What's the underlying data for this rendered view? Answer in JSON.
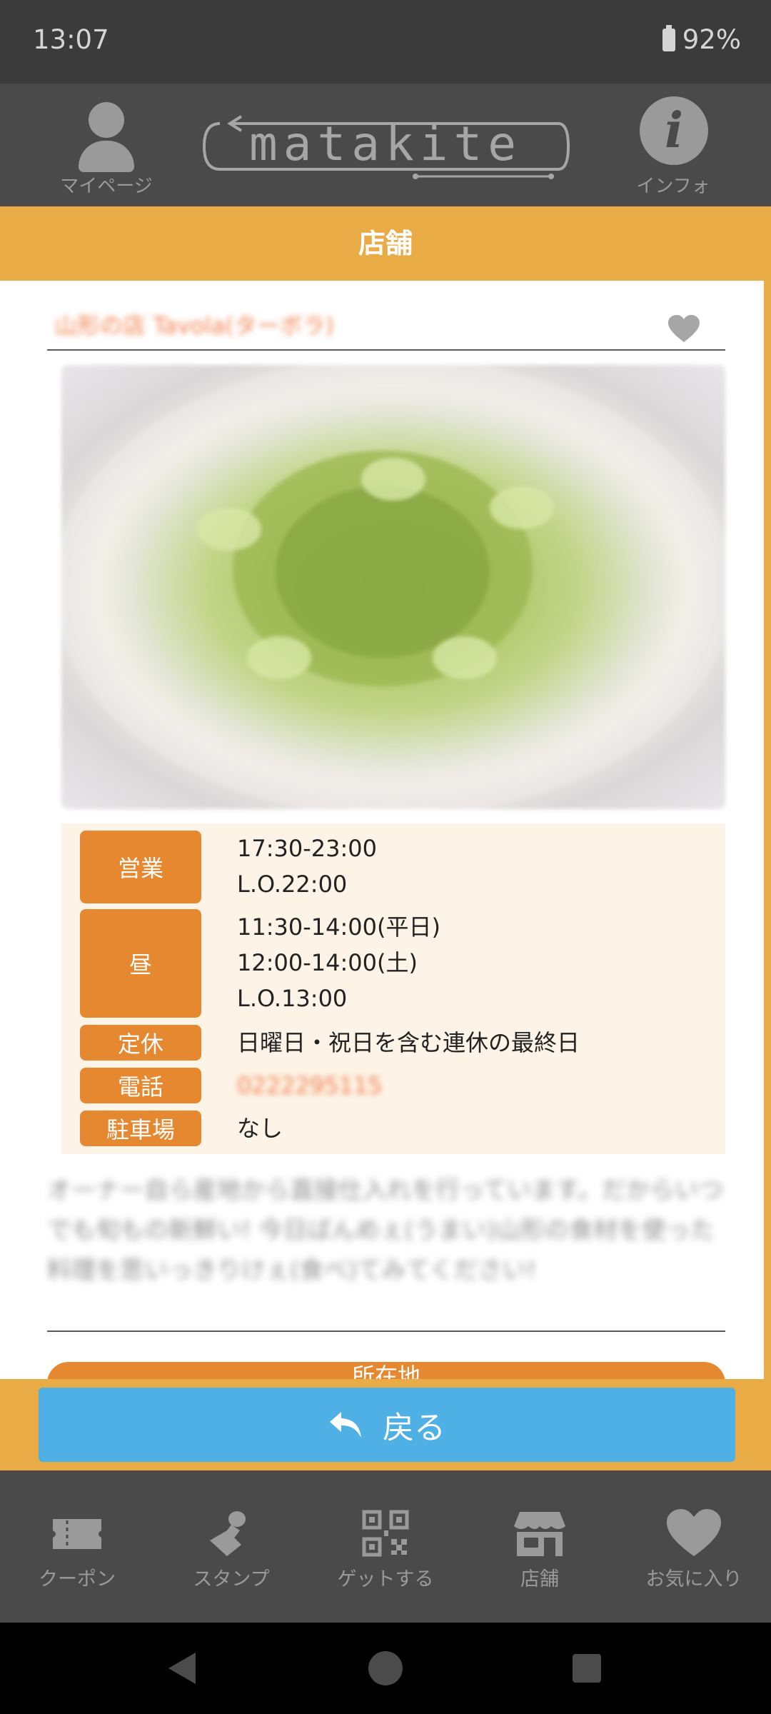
{
  "status_bar": {
    "time": "13:07",
    "battery": "92%"
  },
  "header": {
    "mypage_label": "マイページ",
    "logo_text": "matakite",
    "info_label": "インフォ"
  },
  "page_title": "店舗",
  "shop": {
    "name": "山形の店 Tavola(ターボラ)",
    "info": [
      {
        "label": "営業",
        "lines": [
          "17:30-23:00",
          "L.O.22:00"
        ]
      },
      {
        "label": "昼",
        "lines": [
          "11:30-14:00(平日)",
          "12:00-14:00(土)",
          "L.O.13:00"
        ]
      },
      {
        "label": "定休",
        "lines": [
          "日曜日・祝日を含む連休の最終日"
        ]
      },
      {
        "label": "電話",
        "lines": [
          "0222295115"
        ]
      },
      {
        "label": "駐車場",
        "lines": [
          "なし"
        ]
      }
    ],
    "description": "オーナー自ら産地から直接仕入れを行っています。だからいつでも旬もの新鮮い! 今日ばんめぇ(うまい)山形の食材を使った料理を思いっきりけぇ(食べ)てみてください!",
    "location_button": "所在地"
  },
  "back_button": {
    "label": "戻る"
  },
  "tabs": [
    {
      "label": "クーポン",
      "icon": "ticket-icon"
    },
    {
      "label": "スタンプ",
      "icon": "stamp-icon"
    },
    {
      "label": "ゲットする",
      "icon": "qr-code-icon"
    },
    {
      "label": "店舗",
      "icon": "store-icon"
    },
    {
      "label": "お気に入り",
      "icon": "heart-icon"
    }
  ],
  "colors": {
    "accent": "#e8ab46",
    "tag": "#e6882f",
    "back_button": "#4fb0e6",
    "header": "#4a4a4a"
  }
}
